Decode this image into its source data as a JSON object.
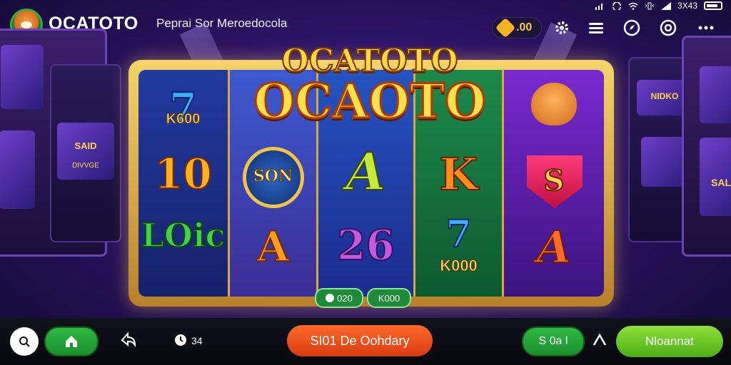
{
  "header": {
    "brand": "OCATOTO",
    "subtitle": "Peprai Sor Meroedocola",
    "balance": ".00",
    "status_text": "3X43"
  },
  "game": {
    "title_small": "OCATOTO",
    "title_big": "OCAOTO",
    "reel_symbols": [
      [
        "7",
        "K600",
        "10",
        "LOic"
      ],
      [
        "SON",
        "A"
      ],
      [
        "A",
        "26"
      ],
      [
        "K",
        "7",
        "K000"
      ],
      [
        "fox",
        "S",
        "A"
      ]
    ],
    "side_left_text": "SAID",
    "side_left_label": "DIVVGE",
    "side_right_text": "NIDKO",
    "side_right_label": "SAL",
    "win_chips": [
      "020",
      "K000"
    ]
  },
  "bottom": {
    "spin_counter": "34",
    "cta_label": "SI01 De Oohdary",
    "bet_label": "S 0a l",
    "main_action": "Nloannat"
  },
  "colors": {
    "accent_green": "#2fb944",
    "accent_orange": "#ff6a2a",
    "gold": "#f6d46a"
  }
}
